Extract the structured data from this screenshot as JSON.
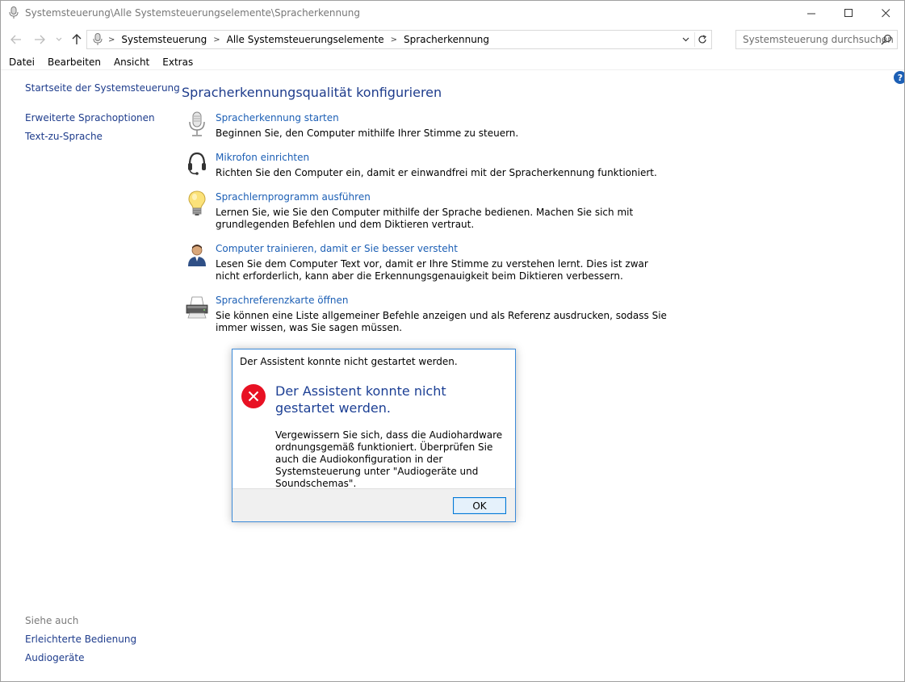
{
  "window": {
    "title": "Systemsteuerung\\Alle Systemsteuerungselemente\\Spracherkennung",
    "controls": {
      "minimize": "—",
      "maximize": "☐",
      "close": "✕"
    }
  },
  "address": {
    "crumbs": [
      "Systemsteuerung",
      "Alle Systemsteuerungselemente",
      "Spracherkennung"
    ],
    "search_placeholder": "Systemsteuerung durchsuchen"
  },
  "menu": [
    "Datei",
    "Bearbeiten",
    "Ansicht",
    "Extras"
  ],
  "sidebar": {
    "home": "Startseite der Systemsteuerung",
    "links": [
      "Erweiterte Sprachoptionen",
      "Text-zu-Sprache"
    ],
    "see_also_heading": "Siehe auch",
    "see_also": [
      "Erleichterte Bedienung",
      "Audiogeräte"
    ]
  },
  "main": {
    "title": "Spracherkennungsqualität konfigurieren",
    "tasks": [
      {
        "icon": "microphone-icon",
        "link": "Spracherkennung starten",
        "desc": "Beginnen Sie, den Computer mithilfe Ihrer Stimme zu steuern."
      },
      {
        "icon": "headset-icon",
        "link": "Mikrofon einrichten",
        "desc": "Richten Sie den Computer ein, damit er einwandfrei mit der Spracherkennung funktioniert."
      },
      {
        "icon": "lightbulb-icon",
        "link": "Sprachlernprogramm ausführen",
        "desc": "Lernen Sie, wie Sie den Computer mithilfe der Sprache bedienen. Machen Sie sich mit grundlegenden Befehlen und dem Diktieren vertraut."
      },
      {
        "icon": "user-icon",
        "link": "Computer trainieren, damit er Sie besser versteht",
        "desc": "Lesen Sie dem Computer Text vor, damit er Ihre Stimme zu verstehen lernt. Dies ist zwar nicht erforderlich, kann aber die Erkennungsgenauigkeit beim Diktieren verbessern."
      },
      {
        "icon": "printer-icon",
        "link": "Sprachreferenzkarte öffnen",
        "desc": "Sie können eine Liste allgemeiner Befehle anzeigen und als Referenz ausdrucken, sodass Sie immer wissen, was Sie sagen müssen."
      }
    ]
  },
  "dialog": {
    "title": "Der Assistent konnte nicht gestartet werden.",
    "main_instruction": "Der Assistent konnte nicht gestartet werden.",
    "content": "Vergewissern Sie sich, dass die Audiohardware ordnungsgemäß funktioniert. Überprüfen Sie auch die Audiokonfiguration in der Systemsteuerung unter \"Audiogeräte und Soundschemas\".",
    "ok_label": "OK"
  },
  "colors": {
    "link": "#1c5fb5",
    "heading": "#1e3c8c",
    "error": "#e81123",
    "dialog_border": "#3c8ad8"
  }
}
